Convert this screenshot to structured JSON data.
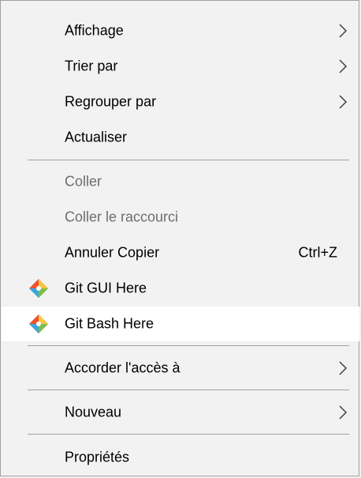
{
  "menu": {
    "items": [
      {
        "label": "Affichage",
        "submenu": true
      },
      {
        "label": "Trier par",
        "submenu": true
      },
      {
        "label": "Regrouper par",
        "submenu": true
      },
      {
        "label": "Actualiser"
      },
      {
        "label": "Coller",
        "disabled": true
      },
      {
        "label": "Coller le raccourci",
        "disabled": true
      },
      {
        "label": "Annuler Copier",
        "shortcut": "Ctrl+Z"
      },
      {
        "label": "Git GUI Here",
        "icon": "git-gui-icon"
      },
      {
        "label": "Git Bash Here",
        "icon": "git-bash-icon",
        "highlighted": true
      },
      {
        "label": "Accorder l'accès à",
        "submenu": true
      },
      {
        "label": "Nouveau",
        "submenu": true
      },
      {
        "label": "Propriétés"
      }
    ]
  },
  "colors": {
    "background": "#f2f2f2",
    "highlight": "#ffffff",
    "separator": "#a0a0a0",
    "disabled_text": "#6d6d6d"
  }
}
